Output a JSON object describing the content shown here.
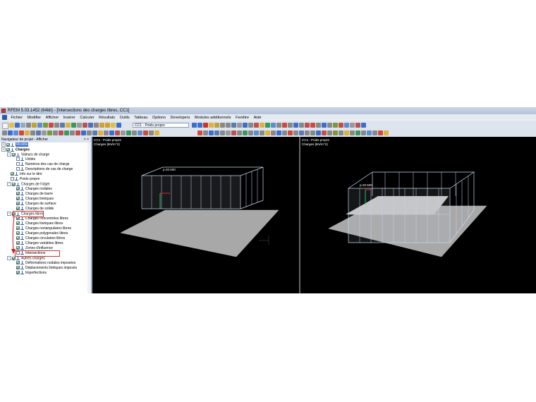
{
  "window": {
    "title": "RFEM 5.03.1452 (64bit) - [Intersections des charges libres, CC1]"
  },
  "menu": [
    "Fichier",
    "Modifier",
    "Afficher",
    "Insérer",
    "Calculer",
    "Résultats",
    "Outils",
    "Tableau",
    "Options",
    "Developers",
    "Modules additionnels",
    "Fenêtre",
    "Aide"
  ],
  "toolbar": {
    "load_case": "CC1 - Poids propre"
  },
  "navigator": {
    "title": "Navigateur de projet - Afficher",
    "items": [
      {
        "label": "Modèle"
      },
      {
        "label": "Charges"
      },
      {
        "label": "Valeurs de charge"
      },
      {
        "label": "Unités"
      },
      {
        "label": "Numéros des cas de charge"
      },
      {
        "label": "Descriptions de cas de charge"
      },
      {
        "label": "Info sur le titre"
      },
      {
        "label": "Poids propre"
      },
      {
        "label": "Charges de l'objet"
      },
      {
        "label": "Charges nodales"
      },
      {
        "label": "Charges de barre"
      },
      {
        "label": "Charges linéiques"
      },
      {
        "label": "Charges de surface"
      },
      {
        "label": "Charges de solide"
      },
      {
        "label": "Charges libres"
      },
      {
        "label": "Charges concentrées libres"
      },
      {
        "label": "Charges linéiques libres"
      },
      {
        "label": "Charges rectangulaires libres"
      },
      {
        "label": "Charges polygonales libres"
      },
      {
        "label": "Charges circulaires libres"
      },
      {
        "label": "Charges variables libres"
      },
      {
        "label": "Zones d'influence"
      },
      {
        "label": "Intersections"
      },
      {
        "label": "Autres charges"
      },
      {
        "label": "Déformations nodales imposées"
      },
      {
        "label": "Déplacements linéiques imposés"
      },
      {
        "label": "Imperfections"
      }
    ]
  },
  "views": [
    {
      "case": "CC1 : Poids propre",
      "unit": "Charges [kN/m^2]",
      "value_label": "p-20.500"
    },
    {
      "case": "CC1 : Poids propre",
      "unit": "Charges [kN/m^2]",
      "value_label": "p-20.500"
    }
  ],
  "colors": {
    "highlight": "#d03030",
    "model_select": "#3a6fd0",
    "plate": "#a8a8a8",
    "load_lines": "#c8d8f0"
  }
}
